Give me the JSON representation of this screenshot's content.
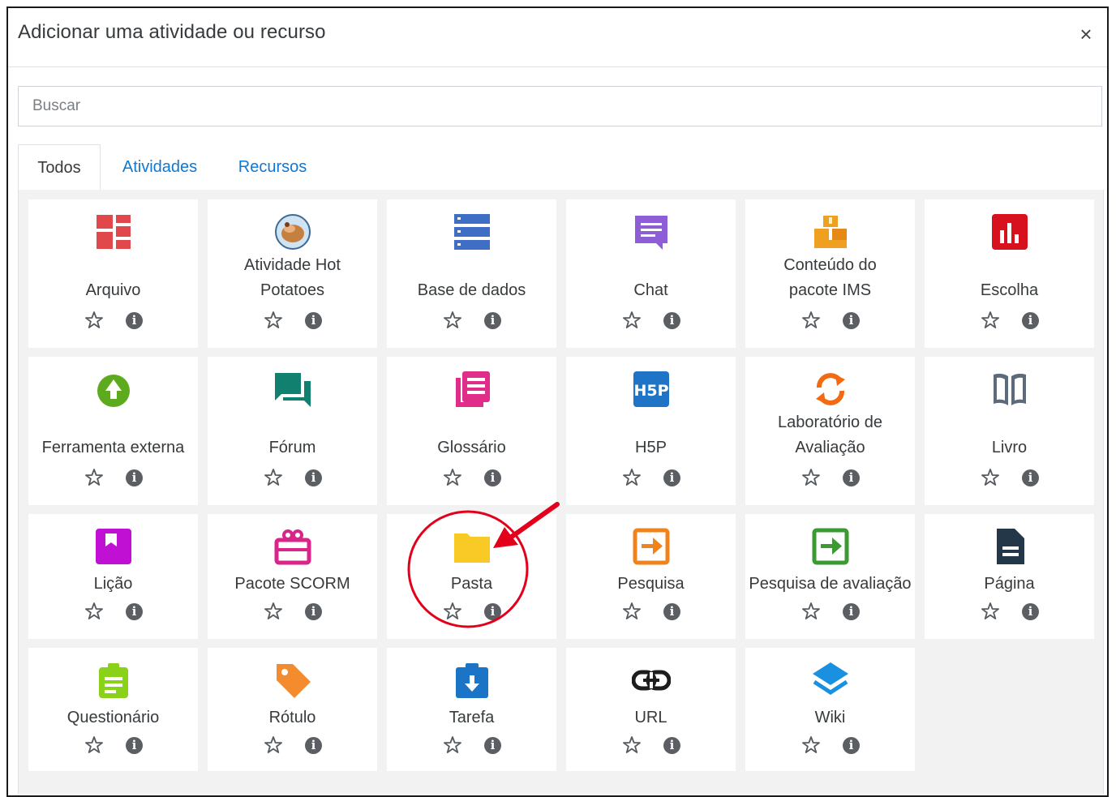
{
  "header": {
    "title": "Adicionar uma atividade ou recurso",
    "close_label": "×"
  },
  "search": {
    "placeholder": "Buscar"
  },
  "tabs": [
    {
      "label": "Todos",
      "active": true
    },
    {
      "label": "Atividades",
      "active": false
    },
    {
      "label": "Recursos",
      "active": false
    }
  ],
  "items": [
    {
      "label": "Arquivo",
      "icon": "file-icon",
      "color": "#e0484b"
    },
    {
      "label": "Atividade Hot Potatoes",
      "icon": "hot-potatoes-icon",
      "color": "#c57f3f"
    },
    {
      "label": "Base de dados",
      "icon": "database-icon",
      "color": "#3e6fc4"
    },
    {
      "label": "Chat",
      "icon": "chat-icon",
      "color": "#8e5ed6"
    },
    {
      "label": "Conteúdo do pacote IMS",
      "icon": "ims-package-icon",
      "color": "#f0a020"
    },
    {
      "label": "Escolha",
      "icon": "choice-chart-icon",
      "color": "#d7111e"
    },
    {
      "label": "Ferramenta externa",
      "icon": "external-tool-icon",
      "color": "#5daa1f"
    },
    {
      "label": "Fórum",
      "icon": "forum-icon",
      "color": "#11806e"
    },
    {
      "label": "Glossário",
      "icon": "glossary-icon",
      "color": "#e02d8a"
    },
    {
      "label": "H5P",
      "icon": "h5p-icon",
      "color": "#1f74c6"
    },
    {
      "label": "Laboratório de Avaliação",
      "icon": "workshop-icon",
      "color": "#f36a12"
    },
    {
      "label": "Livro",
      "icon": "book-icon",
      "color": "#5b6b7b"
    },
    {
      "label": "Lição",
      "icon": "lesson-icon",
      "color": "#c010d4"
    },
    {
      "label": "Pacote SCORM",
      "icon": "scorm-icon",
      "color": "#d9248a"
    },
    {
      "label": "Pasta",
      "icon": "folder-icon",
      "color": "#f9c926"
    },
    {
      "label": "Pesquisa",
      "icon": "survey-icon",
      "color": "#f0831b"
    },
    {
      "label": "Pesquisa de avaliação",
      "icon": "feedback-icon",
      "color": "#3b9a32"
    },
    {
      "label": "Página",
      "icon": "page-icon",
      "color": "#233748"
    },
    {
      "label": "Questionário",
      "icon": "quiz-icon",
      "color": "#8ad11a"
    },
    {
      "label": "Rótulo",
      "icon": "label-tag-icon",
      "color": "#f48b2c"
    },
    {
      "label": "Tarefa",
      "icon": "assignment-icon",
      "color": "#1b74c5"
    },
    {
      "label": "URL",
      "icon": "url-link-icon",
      "color": "#1d1d1d"
    },
    {
      "label": "Wiki",
      "icon": "wiki-layers-icon",
      "color": "#1a90e0"
    }
  ],
  "info_glyph": "i"
}
